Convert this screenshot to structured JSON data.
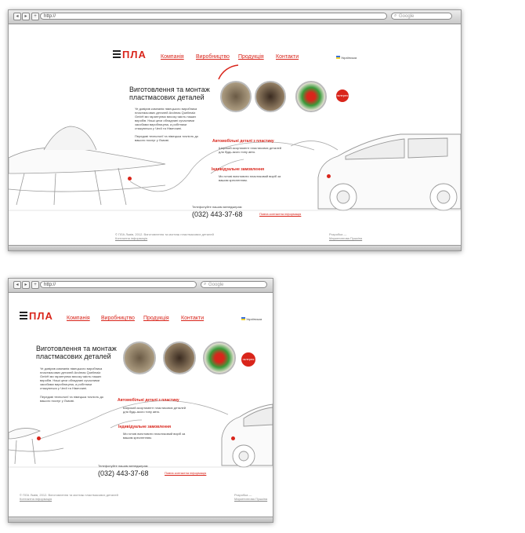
{
  "browser": {
    "nav_back": "◂",
    "nav_forward": "▸",
    "new_tab": "+",
    "url": "http://",
    "search_placeholder": "Google"
  },
  "site": {
    "logo_text": "ПЛА",
    "nav": [
      "Компанія",
      "Виробництво",
      "Продукція",
      "Контакти"
    ],
    "language": "Українська",
    "headline": "Виготовлення та монтаж пластмасових деталей",
    "intro": "Ye довірив компанія німецького виробника пластмасових деталей Andreas Quellmalz GmbH ми гарантуємо високу якість наших виробів. Наші цехи обладнані сучасними засобами виробництва, а робітники стажуються у Чехії та Німеччині.",
    "intro2": "Передові технології та німецька точність до вашого послуг у Львові.",
    "feature1_title": "Автомобільні деталі з пластику",
    "feature1_text": "Широкий асортимент пластикових деталей для будь-якого типу авто.",
    "feature2_title": "Індивідуальне замовлення",
    "feature2_text": "Ми готові виготовити пластиковий виріб за вашим кресленням.",
    "phone_label": "Телефонуйте нашим менеджерам",
    "phone": "(032) 443-37-68",
    "contact_link": "Повна контактна інформація",
    "badge": "галерея",
    "footer_copy": "© ПЛА Львів, 2012. Виготовлення та монтаж пластмасових деталей",
    "footer_contacts": "Контактна інформація",
    "footer_dev_label": "Розробка —",
    "footer_dev": "Маркетингова Пушкiна"
  },
  "colors": {
    "accent": "#d9251b",
    "text": "#222222",
    "line": "#bbbbbb"
  }
}
